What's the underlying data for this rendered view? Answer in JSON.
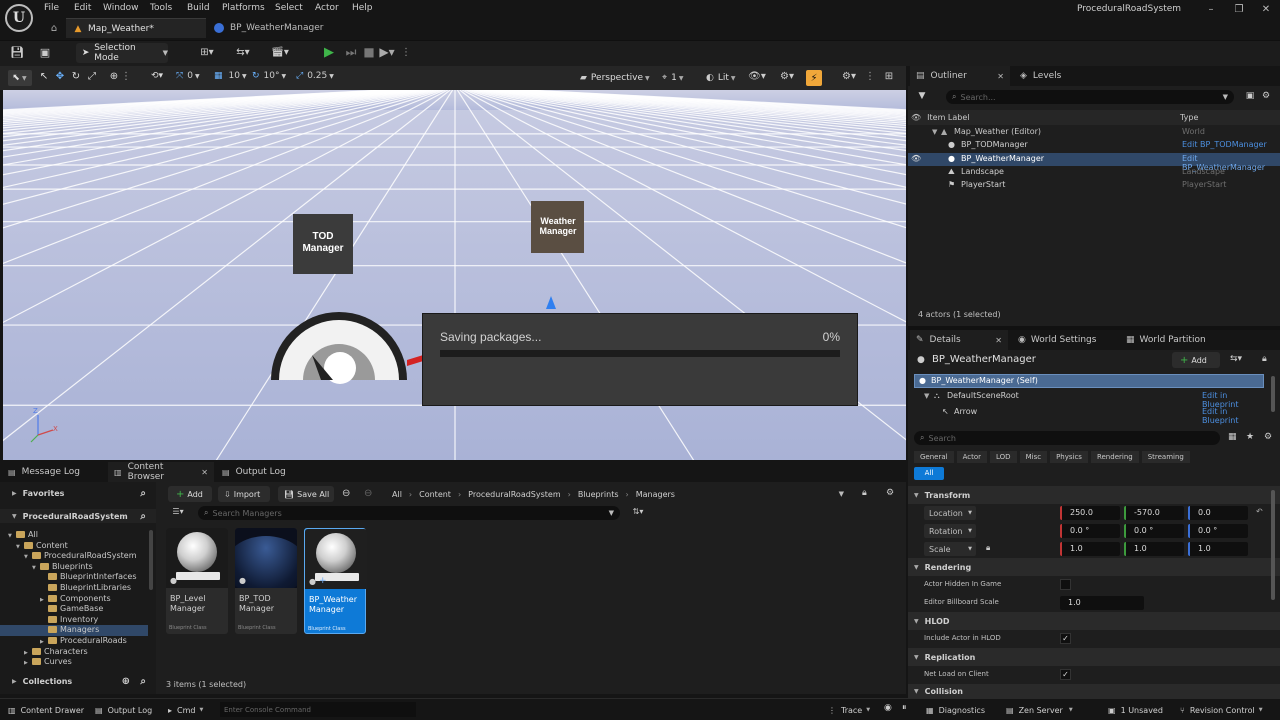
{
  "window": {
    "app_title": "ProceduralRoadSystem",
    "menu": [
      "File",
      "Edit",
      "Window",
      "Tools",
      "Build",
      "Platforms",
      "Select",
      "Actor",
      "Help"
    ],
    "tabs": [
      {
        "label": "Map_Weather*"
      },
      {
        "label": "BP_WeatherManager"
      }
    ]
  },
  "toolbar": {
    "mode_label": "Selection Mode"
  },
  "viewport": {
    "view_mode": "Perspective",
    "lit_label": "Lit",
    "camera_count": "1",
    "snap_values": {
      "translate": "0",
      "grid": "10",
      "rotate": "10°",
      "scale": "0.25"
    },
    "labels": {
      "tod": "TOD\nManager",
      "weather": "Weather\nManager"
    },
    "saving": {
      "title": "Saving packages...",
      "percent": "0%",
      "progress": 0
    }
  },
  "outliner": {
    "tabs": [
      "Outliner",
      "Levels"
    ],
    "search_placeholder": "Search...",
    "columns": {
      "label": "Item Label",
      "type": "Type"
    },
    "items": [
      {
        "label": "Map_Weather (Editor)",
        "type": "World",
        "indent": 0
      },
      {
        "label": "BP_TODManager",
        "type": "Edit BP_TODManager",
        "indent": 1
      },
      {
        "label": "BP_WeatherManager",
        "type": "Edit BP_WeatherManager",
        "indent": 1,
        "selected": true
      },
      {
        "label": "Landscape",
        "type": "Landscape",
        "indent": 1
      },
      {
        "label": "PlayerStart",
        "type": "PlayerStart",
        "indent": 1
      }
    ],
    "footer": "4 actors (1 selected)"
  },
  "details": {
    "tabs": [
      "Details",
      "World Settings",
      "World Partition"
    ],
    "actor_name": "BP_WeatherManager",
    "add_label": "Add",
    "components": [
      {
        "label": "BP_WeatherManager (Self)",
        "link": ""
      },
      {
        "label": "DefaultSceneRoot",
        "link": "Edit in Blueprint"
      },
      {
        "label": "Arrow",
        "link": "Edit in Blueprint"
      }
    ],
    "search_placeholder": "Search",
    "filters": [
      "General",
      "Actor",
      "LOD",
      "Misc",
      "Physics",
      "Rendering",
      "Streaming"
    ],
    "filter_all": "All",
    "transform": {
      "section": "Transform",
      "location": {
        "label": "Location",
        "x": "250.0",
        "y": "-570.0",
        "z": "0.0"
      },
      "rotation": {
        "label": "Rotation",
        "x": "0.0 °",
        "y": "0.0 °",
        "z": "0.0 °"
      },
      "scale": {
        "label": "Scale",
        "x": "1.0",
        "y": "1.0",
        "z": "1.0"
      }
    },
    "rendering": {
      "section": "Rendering",
      "hidden_label": "Actor Hidden In Game",
      "billboard_label": "Editor Billboard Scale",
      "billboard_value": "1.0"
    },
    "hlod": {
      "section": "HLOD",
      "include_label": "Include Actor in HLOD"
    },
    "replication": {
      "section": "Replication",
      "net_label": "Net Load on Client"
    },
    "collision": {
      "section": "Collision"
    }
  },
  "bottom_tabs": [
    "Message Log",
    "Content Browser",
    "Output Log"
  ],
  "content_browser": {
    "favorites": "Favorites",
    "project": "ProceduralRoadSystem",
    "add_label": "Add",
    "import_label": "Import",
    "save_all_label": "Save All",
    "breadcrumb": [
      "All",
      "Content",
      "ProceduralRoadSystem",
      "Blueprints",
      "Managers"
    ],
    "search_placeholder": "Search Managers",
    "tree": [
      {
        "label": "All",
        "indent": 0
      },
      {
        "label": "Content",
        "indent": 1
      },
      {
        "label": "ProceduralRoadSystem",
        "indent": 2
      },
      {
        "label": "Blueprints",
        "indent": 3
      },
      {
        "label": "BlueprintInterfaces",
        "indent": 4
      },
      {
        "label": "BlueprintLibraries",
        "indent": 4
      },
      {
        "label": "Components",
        "indent": 4
      },
      {
        "label": "GameBase",
        "indent": 4
      },
      {
        "label": "Inventory",
        "indent": 4
      },
      {
        "label": "Managers",
        "indent": 4,
        "selected": true
      },
      {
        "label": "ProceduralRoads",
        "indent": 4
      },
      {
        "label": "Characters",
        "indent": 2
      },
      {
        "label": "Curves",
        "indent": 2
      }
    ],
    "collections": "Collections",
    "assets": [
      {
        "name": "BP_Level\nManager",
        "type": "Blueprint Class"
      },
      {
        "name": "BP_TOD\nManager",
        "type": "Blueprint Class"
      },
      {
        "name": "BP_Weather\nManager",
        "type": "Blueprint Class",
        "selected": true
      }
    ],
    "footer": "3 items (1 selected)"
  },
  "statusbar": {
    "content_drawer": "Content Drawer",
    "output_log": "Output Log",
    "cmd": "Cmd",
    "console_placeholder": "Enter Console Command",
    "trace": "Trace",
    "diagnostics": "Diagnostics",
    "zen": "Zen Server",
    "unsaved": "1 Unsaved",
    "revision": "Revision Control"
  },
  "colors": {
    "accent": "#0e7ad7",
    "selected_row": "#304868",
    "play_green": "#3fb54a"
  }
}
